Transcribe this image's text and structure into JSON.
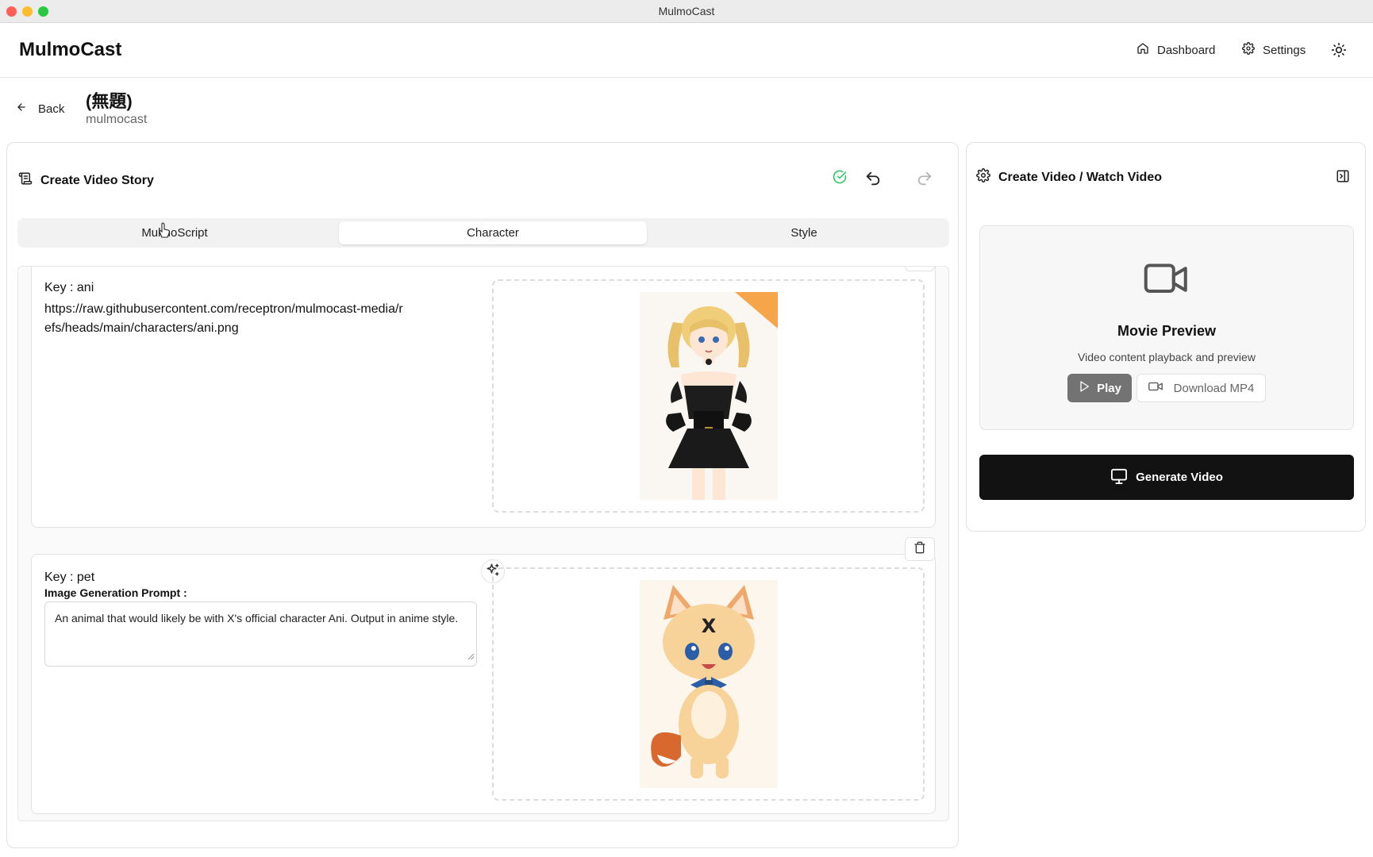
{
  "window": {
    "title": "MulmoCast"
  },
  "header": {
    "brand": "MulmoCast",
    "nav": {
      "dashboard": "Dashboard",
      "settings": "Settings"
    }
  },
  "project": {
    "back_label": "Back",
    "title": "(無題)",
    "subtitle": "mulmocast"
  },
  "editor": {
    "title": "Create Video Story",
    "tabs": [
      {
        "label": "MulmoScript"
      },
      {
        "label": "Character"
      },
      {
        "label": "Style"
      }
    ],
    "characters": [
      {
        "key_label": "Key : ani",
        "url": "https://raw.githubusercontent.com/receptron/mulmocast-media/refs/heads/main/characters/ani.png"
      },
      {
        "key_label": "Key : pet",
        "prompt_label": "Image Generation Prompt :",
        "prompt": "An animal that would likely be with X's official character Ani. Output in anime style."
      }
    ]
  },
  "video_panel": {
    "title": "Create Video / Watch Video",
    "preview_title": "Movie Preview",
    "preview_subtitle": "Video content playback and preview",
    "play_label": "Play",
    "download_label": "Download MP4",
    "generate_label": "Generate Video"
  },
  "colors": {
    "accent_dark": "#121212",
    "success": "#22c55e",
    "play_bg": "#737373"
  }
}
